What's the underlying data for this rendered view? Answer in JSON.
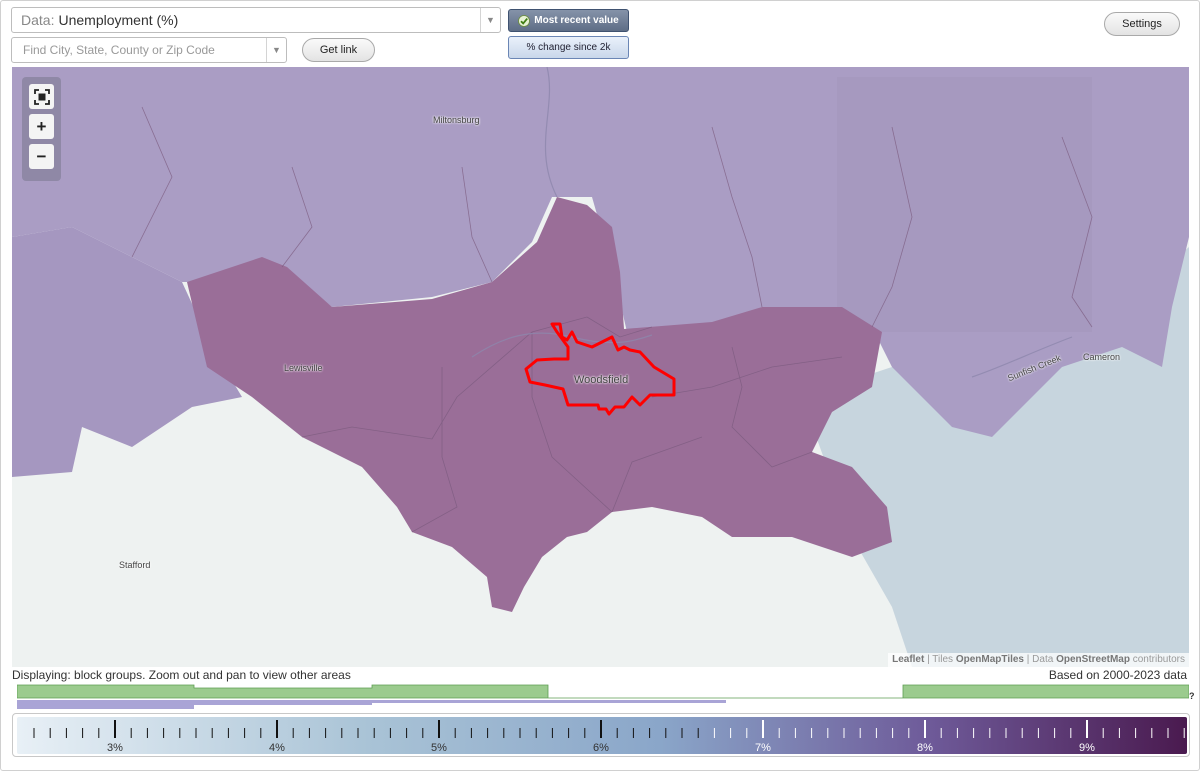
{
  "data_selector": {
    "label": "Data:",
    "value": "Unemployment (%)"
  },
  "search": {
    "placeholder": "Find City, State, County or Zip Code"
  },
  "buttons": {
    "get_link": "Get link",
    "settings": "Settings",
    "most_recent": "Most recent value",
    "pct_change": "% change since 2k"
  },
  "zoom": {
    "fit": "⛶",
    "in": "+",
    "out": "−"
  },
  "map": {
    "places": [
      "Miltonsburg",
      "Lewisville",
      "Woodsfield",
      "Stafford",
      "Cameron",
      "Sunfish Creek"
    ],
    "highlight_place": "Woodsfield",
    "colors": {
      "highlight_outline": "#ff0000",
      "high_value": "#9a6d95",
      "mid_value": "#a89bc1",
      "low_value": "#c5d2dd"
    }
  },
  "attribution": {
    "leaflet": "Leaflet",
    "sep1": " | Tiles ",
    "tiles": "OpenMapTiles",
    "sep2": " | Data ",
    "data": "OpenStreetMap",
    "suffix": " contributors"
  },
  "footer": {
    "display_note": "Displaying: block groups. Zoom out and pan to view other areas",
    "years": "Based on 2000-2023 data",
    "help": "?"
  },
  "legend": {
    "ticks": [
      "3%",
      "4%",
      "5%",
      "6%",
      "7%",
      "8%",
      "9%"
    ],
    "color_low": "#e8f0f6",
    "color_mid": "#8aa6c9",
    "color_high": "#4a1a4f"
  }
}
